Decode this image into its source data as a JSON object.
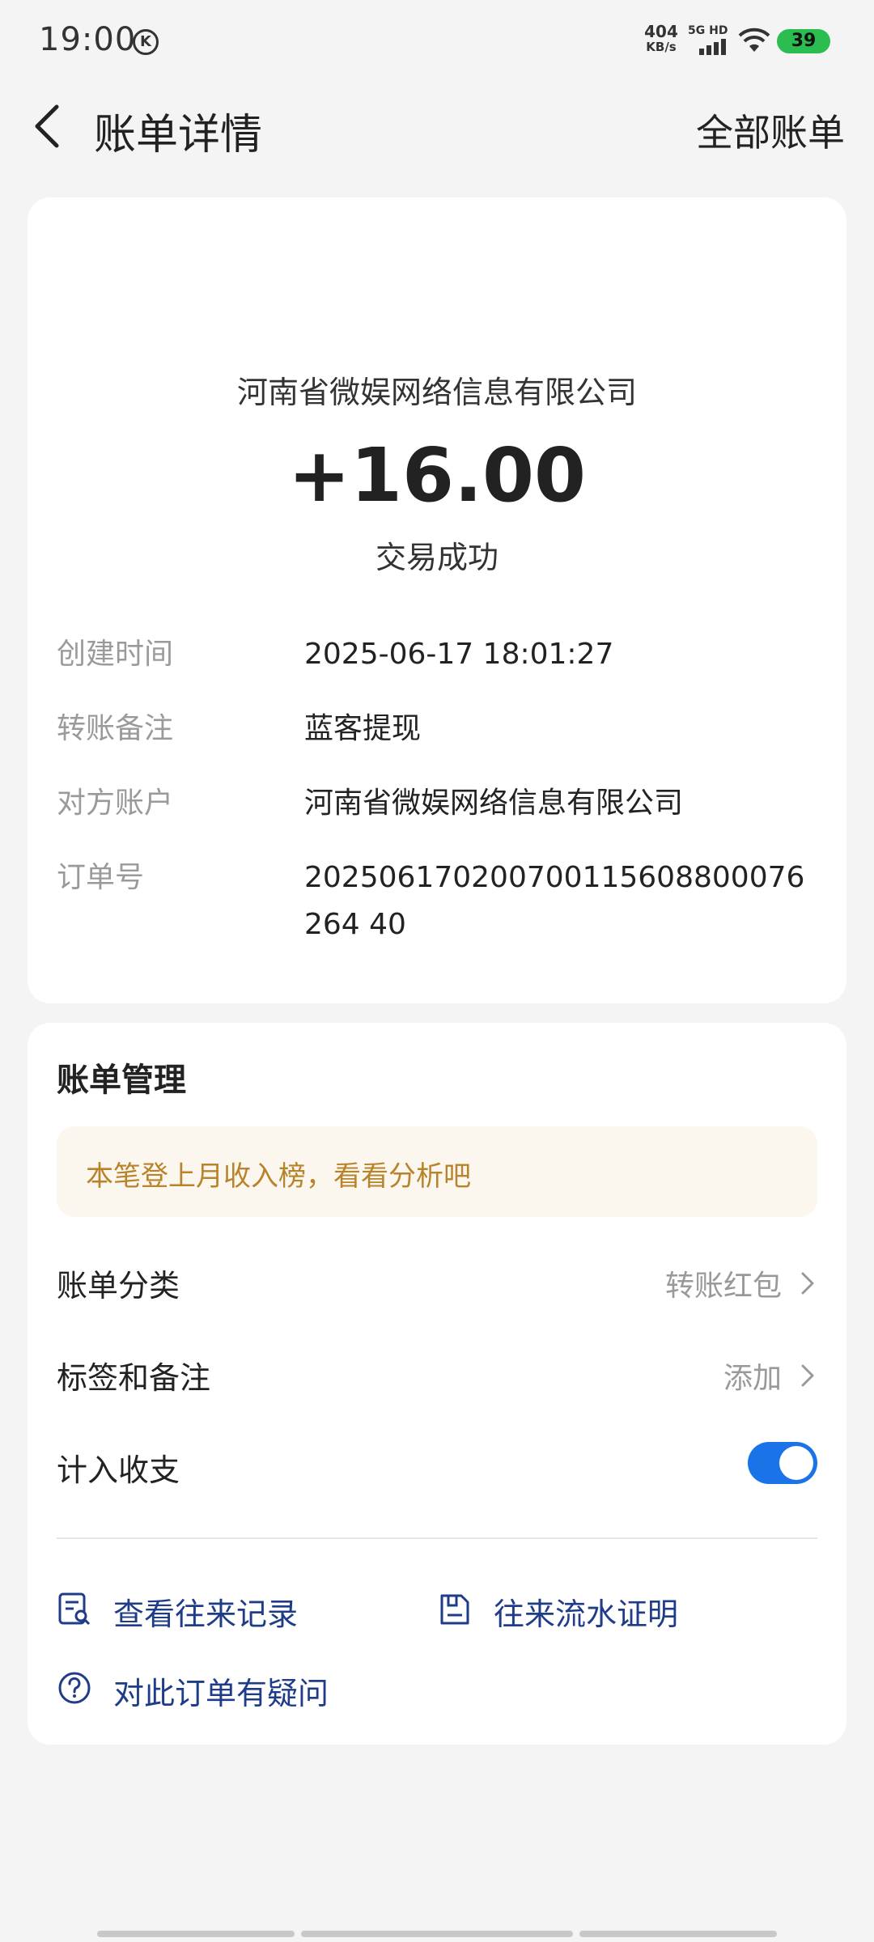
{
  "status_bar": {
    "time": "19:00",
    "k_badge": "K",
    "net_speed_value": "404",
    "net_speed_unit": "KB/s",
    "network": "5G HD",
    "battery": "39"
  },
  "nav": {
    "title": "账单详情",
    "right_link": "全部账单"
  },
  "transaction": {
    "payee": "河南省微娱网络信息有限公司",
    "amount": "+16.00",
    "status": "交易成功",
    "details": [
      {
        "label": "创建时间",
        "value": "2025-06-17 18:01:27"
      },
      {
        "label": "转账备注",
        "value": "蓝客提现"
      },
      {
        "label": "对方账户",
        "value": "河南省微娱网络信息有限公司"
      },
      {
        "label": "订单号",
        "value": "202506170200700115608800076264 40"
      }
    ]
  },
  "management": {
    "title": "账单管理",
    "tip": "本笔登上月收入榜，看看分析吧",
    "category_label": "账单分类",
    "category_value": "转账红包",
    "tags_label": "标签和备注",
    "tags_value": "添加",
    "include_label": "计入收支",
    "include_enabled": true,
    "links": {
      "records": "查看往来记录",
      "statement": "往来流水证明",
      "question": "对此订单有疑问"
    }
  },
  "colors": {
    "link": "#1f3c88",
    "toggle": "#1a73e8",
    "tip_text": "#b8832b",
    "battery": "#2bbd4f"
  }
}
